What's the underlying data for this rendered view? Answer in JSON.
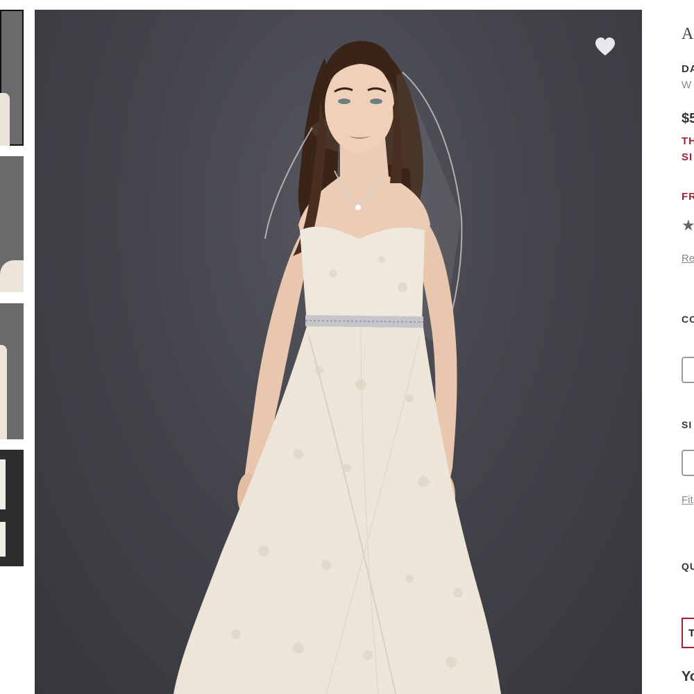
{
  "thumbnails": [
    {
      "label": "thumbnail-1",
      "selected": true
    },
    {
      "label": "thumbnail-2",
      "selected": false
    },
    {
      "label": "thumbnail-3",
      "selected": false
    },
    {
      "label": "thumbnail-4",
      "selected": false
    }
  ],
  "product": {
    "title": "A",
    "brand": "DA",
    "category": "W",
    "price": "$5",
    "promo_line1": "TH",
    "promo_line2": "SI",
    "shipping": "FR",
    "stars": "★",
    "reviews_link": "Re"
  },
  "options": {
    "color_label": "CO",
    "size_label": "SI",
    "fit_link": "Fit",
    "quantity_label": "QU"
  },
  "actions": {
    "try_on_label": "T"
  },
  "footer": {
    "heading": "Yo"
  },
  "colors": {
    "accent": "#a31f34",
    "background_photo": "#44454c"
  }
}
